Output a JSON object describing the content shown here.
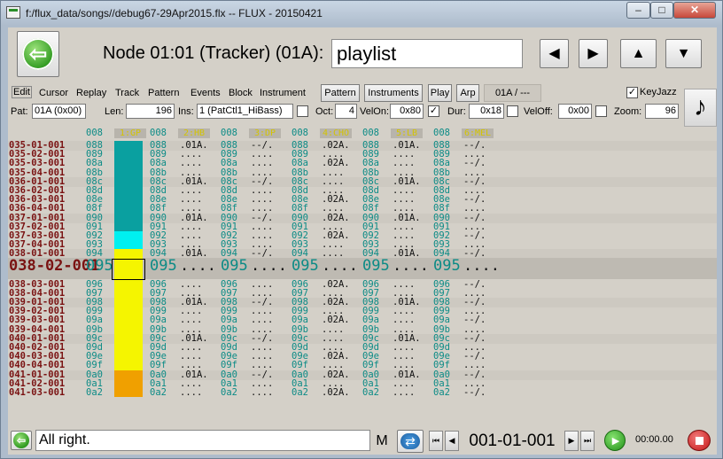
{
  "window": {
    "title": "f:/flux_data/songs//debug67-29Apr2015.flx -- FLUX - 20150421",
    "buttons": {
      "minimize": "–",
      "maximize": "□",
      "close": "✕"
    }
  },
  "node": {
    "label": "Node 01:01 (Tracker) (01A):",
    "name": "playlist"
  },
  "menu": {
    "items": [
      "Edit",
      "Cursor",
      "Replay",
      "Track",
      "Pattern",
      "Events",
      "Block",
      "Instrument"
    ],
    "tool_buttons": [
      "Pattern",
      "Instruments",
      "Play",
      "Arp"
    ],
    "pattern_display": "01A / ---",
    "keyjazz_label": "KeyJazz",
    "keyjazz_checked": true
  },
  "params": {
    "pat_label": "Pat:",
    "pat_value": "01A (0x00)",
    "len_label": "Len:",
    "len_value": "196",
    "ins_label": "Ins:",
    "ins_value": "1 (PatCtl1_HiBass)",
    "oct_label": "Oct:",
    "oct_value": "4",
    "velon_label": "VelOn:",
    "velon_value": "0x80",
    "dur_label": "Dur:",
    "dur_value": "0x18",
    "veloff_label": "VelOff:",
    "veloff_value": "0x00",
    "zoom_label": "Zoom:",
    "zoom_value": "96"
  },
  "grid": {
    "track_headers": [
      "1:GP",
      "2:HB",
      "3:DP",
      "4:CHO",
      "5:LB",
      "6:MEL"
    ],
    "header_row_label": "008",
    "rows": [
      {
        "pos": "035-01-001",
        "step": "088"
      },
      {
        "pos": "035-02-001",
        "step": "089"
      },
      {
        "pos": "035-03-001",
        "step": "08a"
      },
      {
        "pos": "035-04-001",
        "step": "08b"
      },
      {
        "pos": "036-01-001",
        "step": "08c"
      },
      {
        "pos": "036-02-001",
        "step": "08d"
      },
      {
        "pos": "036-03-001",
        "step": "08e"
      },
      {
        "pos": "036-04-001",
        "step": "08f"
      },
      {
        "pos": "037-01-001",
        "step": "090"
      },
      {
        "pos": "037-02-001",
        "step": "091"
      },
      {
        "pos": "037-03-001",
        "step": "092"
      },
      {
        "pos": "037-04-001",
        "step": "093"
      },
      {
        "pos": "038-01-001",
        "step": "094"
      },
      {
        "pos": "038-02-001",
        "step": "095"
      },
      {
        "pos": "038-03-001",
        "step": "096"
      },
      {
        "pos": "038-04-001",
        "step": "097"
      },
      {
        "pos": "039-01-001",
        "step": "098"
      },
      {
        "pos": "039-02-001",
        "step": "099"
      },
      {
        "pos": "039-03-001",
        "step": "09a"
      },
      {
        "pos": "039-04-001",
        "step": "09b"
      },
      {
        "pos": "040-01-001",
        "step": "09c"
      },
      {
        "pos": "040-02-001",
        "step": "09d"
      },
      {
        "pos": "040-03-001",
        "step": "09e"
      },
      {
        "pos": "040-04-001",
        "step": "09f"
      },
      {
        "pos": "041-01-001",
        "step": "0a0"
      },
      {
        "pos": "041-02-001",
        "step": "0a1"
      },
      {
        "pos": "041-03-001",
        "step": "0a2"
      }
    ],
    "empty_cell": "....",
    "event_cells": {
      "hb": ".01A.",
      "dp": "--/.",
      "cho": ".02A.",
      "lb": ".01A.",
      "mel": "--/."
    },
    "cursor_row": "038-02-001",
    "colors": {
      "row_label": "#7a1212",
      "step": "#0b8b86",
      "track1_teal": "#0aa0a0",
      "track1_cyan": "#00f0f0",
      "track1_yellow": "#f5f500",
      "track1_orange": "#f0a000",
      "header_text": "#d4c400"
    }
  },
  "status": {
    "message": "All right.",
    "mode": "M",
    "position": "001-01-001",
    "time": "00:00.00"
  }
}
